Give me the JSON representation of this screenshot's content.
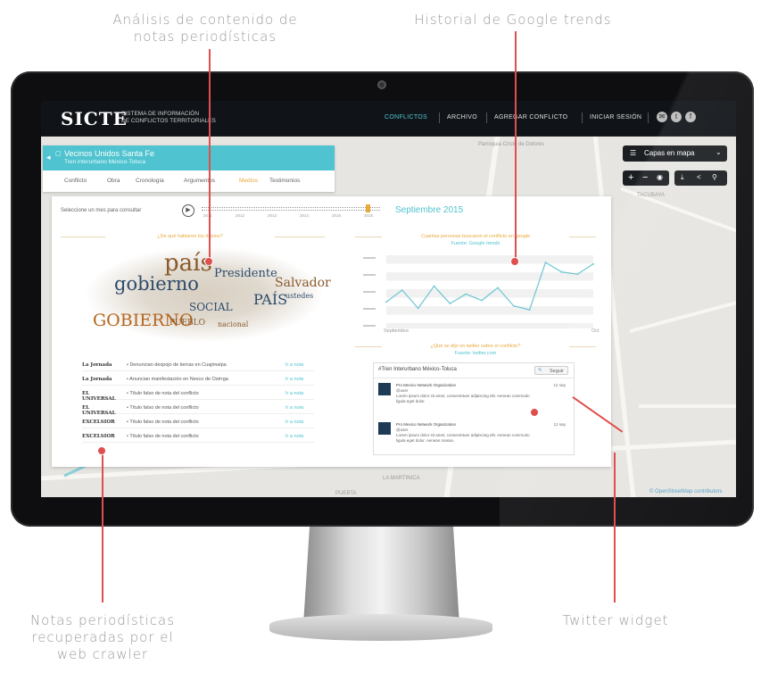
{
  "callouts": {
    "content_analysis": "Análisis de contenido de\nnotas periodísticas",
    "google_trends": "Historial de Google trends",
    "news": "Notas periodísticas\nrecuperadas por el\nweb crawler",
    "twitter": "Twitter widget"
  },
  "app": {
    "logo": "SICTE",
    "tagline": "SISTEMA DE INFORMACIÓN\nDE CONFLICTOS TERRITORIALES",
    "nav": [
      "CONFLICTOS",
      "ARCHIVO",
      "AGREGAR CONFLICTO",
      "INICIAR SESIÓN"
    ],
    "active_nav": "CONFLICTOS",
    "accent": "#4fc3cf",
    "orange": "#e8a93c"
  },
  "map": {
    "labels": [
      "Parroquia Cristo de Dolores",
      "TACUBAYA",
      "LA MARTINICA",
      "PUEBTA"
    ],
    "attribution": "© OpenStreetMap contributors"
  },
  "controls": {
    "layers_label": "Capas en mapa",
    "zoom_in": "+",
    "zoom_out": "−",
    "locate": "◉",
    "download": "⤓",
    "share": "<",
    "pin": "⚲"
  },
  "card": {
    "title": "Vecinos Unidos Santa Fe",
    "subtitle": "Tren interurbano México-Toluca",
    "tabs": [
      "Conflicto",
      "Obra",
      "Cronología",
      "Argumentos",
      "Medios",
      "Testimonios"
    ],
    "active_tab": "Medios"
  },
  "timeline": {
    "prompt": "Seleccione un mes para consultar",
    "years": [
      "2011",
      "2012",
      "2013",
      "2014",
      "2015",
      "2016"
    ],
    "selected": "Septiembre 2015"
  },
  "wordcloud": {
    "heading": "¿De qué hablaron los diarios?",
    "words": [
      {
        "t": "país",
        "c": "#8a5a2b"
      },
      {
        "t": "gobierno",
        "c": "#2d4b6b"
      },
      {
        "t": "GOBIERNO",
        "c": "#b5651d"
      },
      {
        "t": "Presidente",
        "c": "#2d4b6b"
      },
      {
        "t": "Salvador",
        "c": "#8a5a2b"
      },
      {
        "t": "PAÍS",
        "c": "#2d4b6b"
      },
      {
        "t": "SOCIAL",
        "c": "#2d4b6b"
      },
      {
        "t": "PUEBLO",
        "c": "#8a5a2b"
      },
      {
        "t": "ustedes",
        "c": "#2d4b6b"
      },
      {
        "t": "nacional",
        "c": "#8a5a2b"
      }
    ]
  },
  "news": [
    {
      "source": "La Jornada",
      "title": "Denuncian despojo de tierras en Cuajimalpa",
      "link": "Ir a nota"
    },
    {
      "source": "La Jornada",
      "title": "Anuncian manifestación en Nexco de Ostrrga",
      "link": "Ir a nota"
    },
    {
      "source": "EL UNIVERSAL",
      "title": "Título falso de nota del conflicto",
      "link": "Ir a nota"
    },
    {
      "source": "EL UNIVERSAL",
      "title": "Título falso de nota del conflicto",
      "link": "Ir a nota"
    },
    {
      "source": "EXCELSIOR",
      "title": "Título falso de nota del conflicto",
      "link": "Ir a nota"
    },
    {
      "source": "EXCELSIOR",
      "title": "Título falso de nota del conflicto",
      "link": "Ir a nota"
    }
  ],
  "trends": {
    "heading": "Cuantas personas buscaron el conflicto en google",
    "source": "Fuente: Google trends",
    "x_start": "Septiembre",
    "x_end": "Oct",
    "values": [
      20,
      35,
      12,
      40,
      18,
      30,
      22,
      38,
      15,
      10,
      70,
      58,
      55,
      68
    ]
  },
  "twitter": {
    "heading": "¿Qué se dijo en twitter sobre el conflicto?",
    "source": "Fuente: twitter.com",
    "hashtag": "#Tren Interurbano México-Toluca",
    "follow": "Seguir",
    "tweets": [
      {
        "user": "Pro Mexico Network Organization",
        "handle": "@user",
        "time": "12 sep",
        "text": "Lorem ipsum dolor sit amet, consectetuer adipiscing elit. Aenean commodo ligula eget dolor."
      },
      {
        "user": "Pro Mexico Network Organization",
        "handle": "@user",
        "time": "12 sep",
        "text": "Lorem ipsum dolor sit amet, consectetuer adipiscing elit. Aenean commodo ligula eget dolor. Aenean massa."
      }
    ]
  }
}
